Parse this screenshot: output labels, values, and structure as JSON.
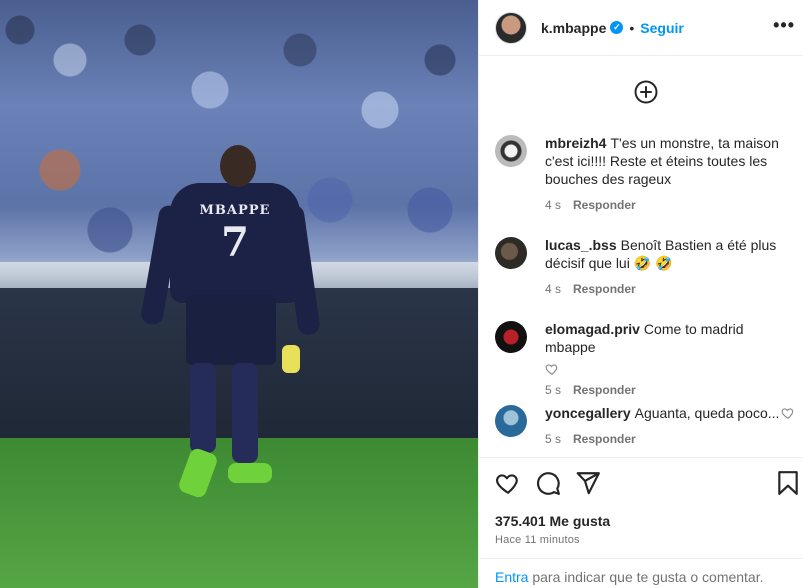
{
  "post": {
    "jersey_name": "MBAPPE",
    "jersey_number": "7"
  },
  "header": {
    "username": "k.mbappe",
    "verified_mark": "✓",
    "separator": "•",
    "follow_label": "Seguir",
    "more_label": "•••"
  },
  "comments": [
    {
      "username": "mbreizh4",
      "text": "T'es un monstre, ta maison c'est ici!!!! Reste et éteins toutes les bouches des rageux",
      "time": "4 s",
      "reply_label": "Responder"
    },
    {
      "username": "lucas_.bss",
      "text": "Benoît Bastien a été plus décisif que lui 🤣 🤣",
      "time": "4 s",
      "reply_label": "Responder"
    },
    {
      "username": "elomagad.priv",
      "text": "Come to madrid mbappe",
      "time": "5 s",
      "reply_label": "Responder"
    },
    {
      "username": "yoncegallery",
      "text": "Aguanta, queda poco...",
      "time": "5 s",
      "reply_label": "Responder"
    }
  ],
  "stats": {
    "likes": "375.401 Me gusta",
    "time_ago": "Hace 11 minutos"
  },
  "footer": {
    "login_label": "Entra",
    "rest_text": " para indicar que te gusta o comentar."
  },
  "icons": {
    "add": "plus-circle-icon",
    "like": "heart-icon",
    "comment": "comment-icon",
    "share": "send-icon",
    "save": "bookmark-icon"
  },
  "colors": {
    "accent": "#0095f6",
    "text": "#262626",
    "muted": "#737373",
    "border": "#efefef"
  }
}
